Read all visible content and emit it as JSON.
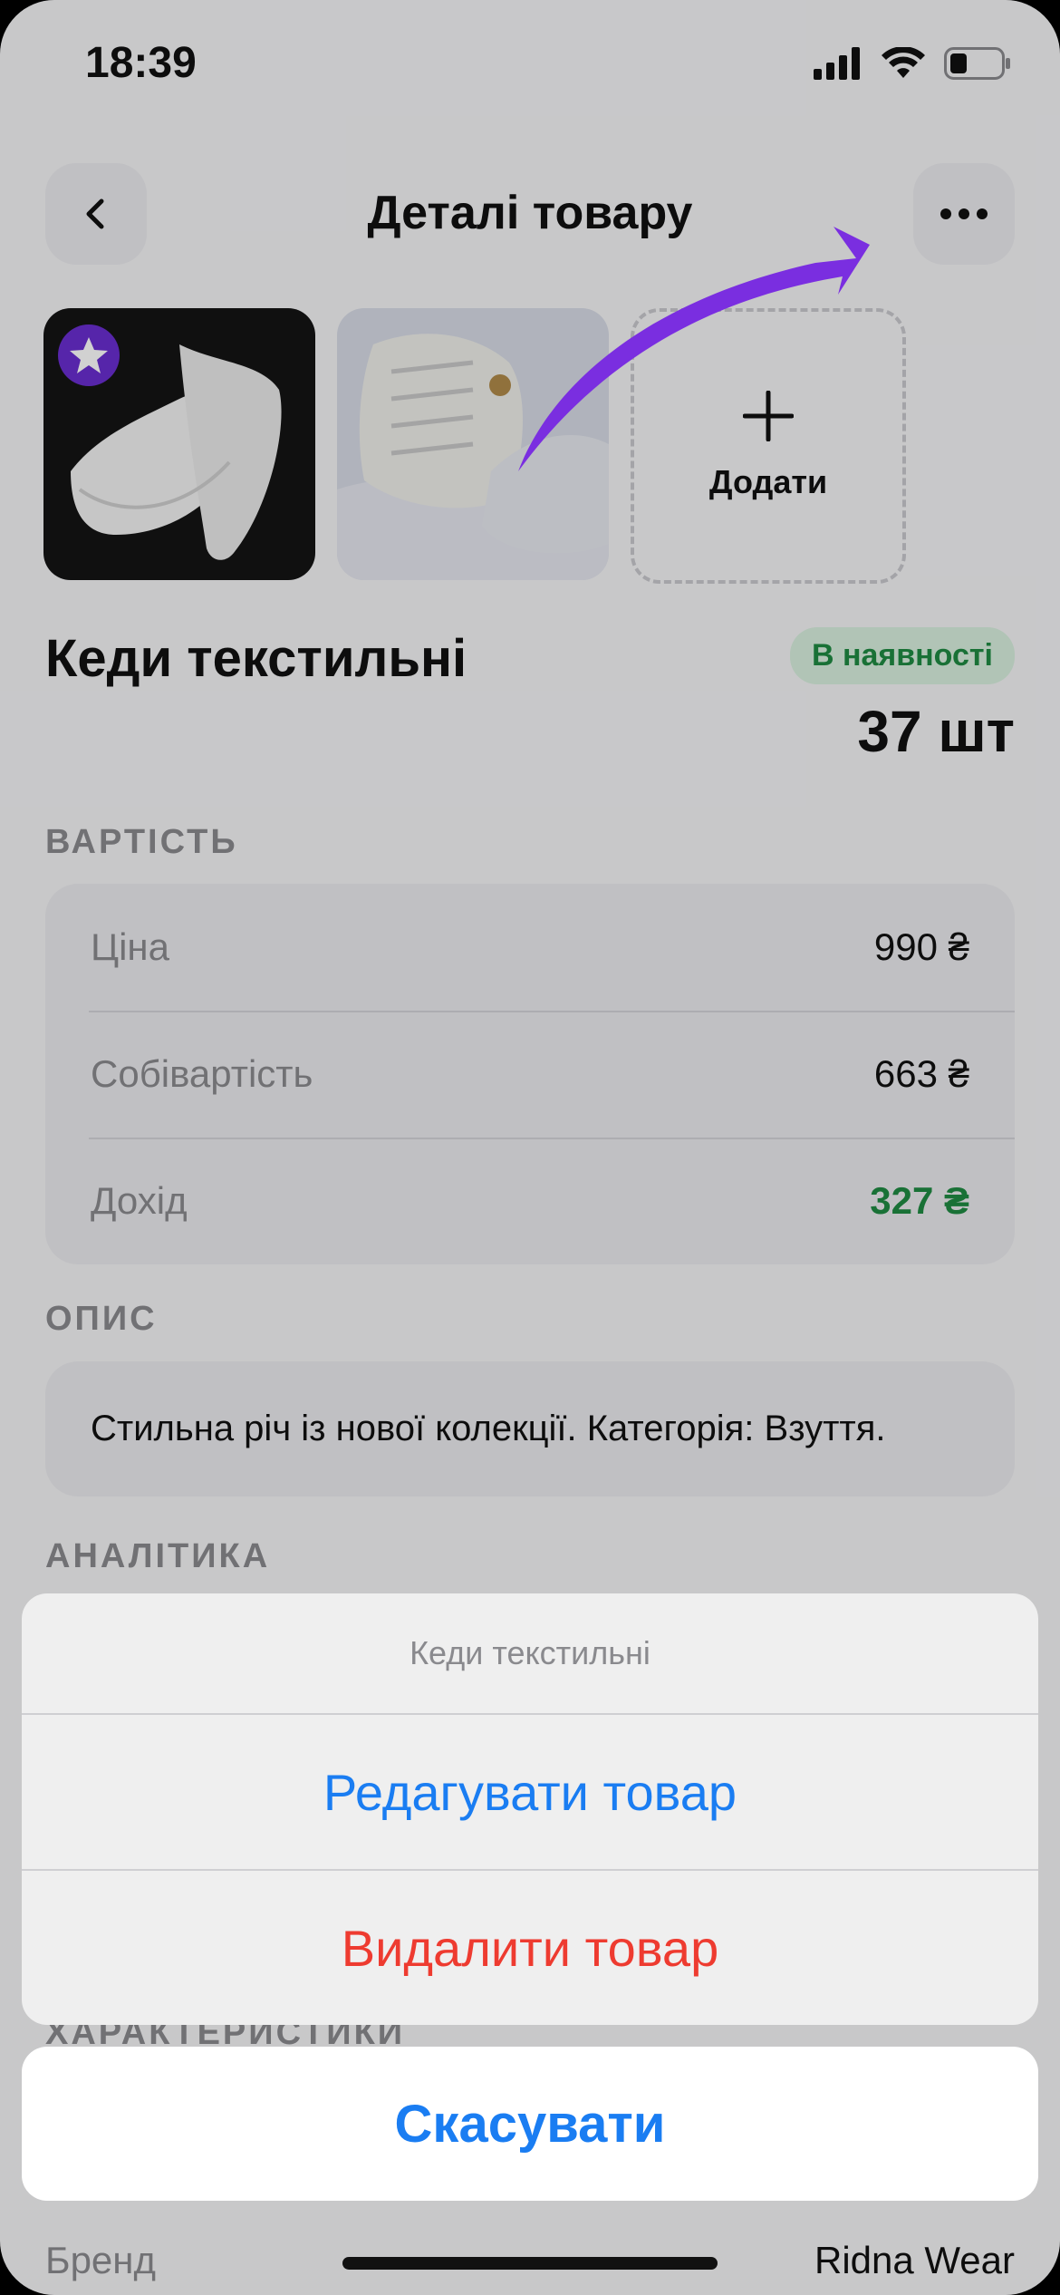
{
  "status": {
    "time": "18:39",
    "icons": [
      "signal-icon",
      "wifi-icon",
      "battery-icon"
    ]
  },
  "nav": {
    "title": "Деталі товару",
    "back_icon": "chevron-left-icon",
    "more_icon": "ellipsis-icon"
  },
  "photos": {
    "add_label": "Додати",
    "items": [
      "sneakers-photo-white-low",
      "sneakers-photo-high-top"
    ]
  },
  "product": {
    "name": "Кеди текстильні",
    "badge": "В наявності",
    "quantity": "37 шт"
  },
  "cost_section": {
    "heading": "ВАРТІСТЬ",
    "rows": [
      {
        "label": "Ціна",
        "value": "990 ₴"
      },
      {
        "label": "Собівартість",
        "value": "663 ₴"
      },
      {
        "label": "Дохід",
        "value": "327 ₴"
      }
    ]
  },
  "description": {
    "heading": "ОПИС",
    "text": "Стильна річ із нової колекції. Категорія: Взуття."
  },
  "analytics": {
    "heading": "АНАЛІТИКА"
  },
  "specs": {
    "heading": "ХАРАКТЕРИСТИКИ",
    "brand_label": "Бренд",
    "brand_value": "Ridna Wear"
  },
  "action_sheet": {
    "title": "Кеди текстильні",
    "edit": "Редагувати товар",
    "delete": "Видалити товар",
    "cancel": "Скасувати"
  },
  "colors": {
    "accent_blue": "#1a7df2",
    "destructive_red": "#ee3b30",
    "success_green": "#1f8a43",
    "annotation_purple": "#7a2ee0"
  }
}
